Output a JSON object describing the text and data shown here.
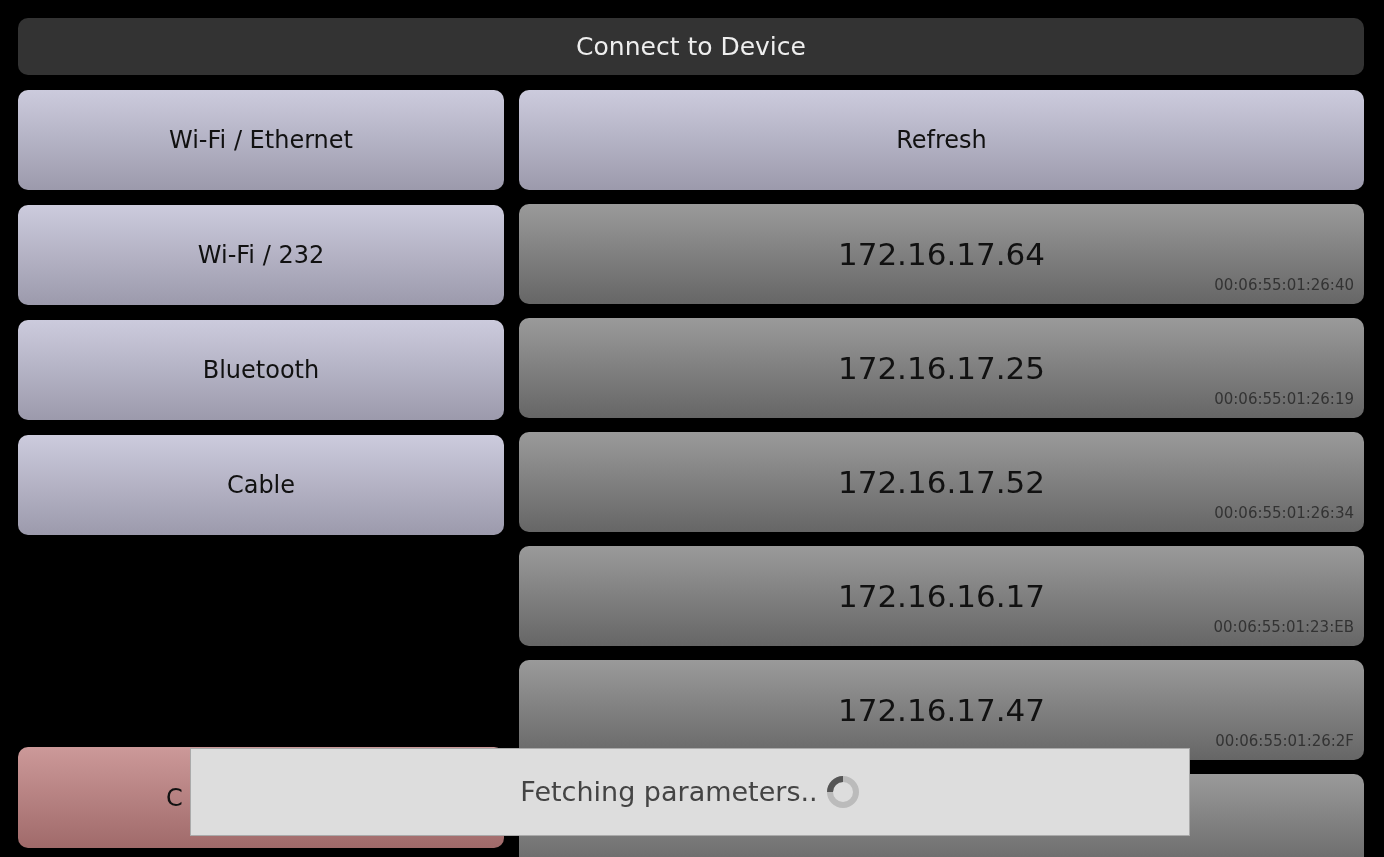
{
  "title": "Connect to Device",
  "connection_types": [
    {
      "label": "Wi-Fi / Ethernet"
    },
    {
      "label": "Wi-Fi / 232"
    },
    {
      "label": "Bluetooth"
    },
    {
      "label": "Cable"
    }
  ],
  "cancel_button": {
    "label": "C"
  },
  "refresh_button": {
    "label": "Refresh"
  },
  "devices": [
    {
      "ip": "172.16.17.64",
      "mac": "00:06:55:01:26:40"
    },
    {
      "ip": "172.16.17.25",
      "mac": "00:06:55:01:26:19"
    },
    {
      "ip": "172.16.17.52",
      "mac": "00:06:55:01:26:34"
    },
    {
      "ip": "172.16.16.17",
      "mac": "00:06:55:01:23:EB"
    },
    {
      "ip": "172.16.17.47",
      "mac": "00:06:55:01:26:2F"
    }
  ],
  "overlay": {
    "message": "Fetching parameters.."
  }
}
